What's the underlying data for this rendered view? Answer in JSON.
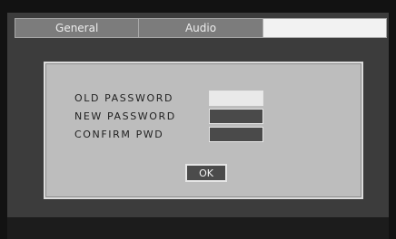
{
  "tabs": [
    {
      "label": "General",
      "active": false
    },
    {
      "label": "Audio",
      "active": false
    },
    {
      "label": "",
      "active": true
    }
  ],
  "dialog": {
    "old_password_label": "OLD PASSWORD",
    "new_password_label": "NEW PASSWORD",
    "confirm_label": "CONFIRM PWD",
    "ok_label": "OK",
    "old_password_value": "",
    "new_password_value": "",
    "confirm_value": ""
  },
  "colors": {
    "tab_inactive": "#7c7c7c",
    "tab_active": "#f2f2f2",
    "dialog_bg": "#bdbdbd",
    "field_selected": "#e9e9e9",
    "field_normal": "#4a4a4a"
  }
}
